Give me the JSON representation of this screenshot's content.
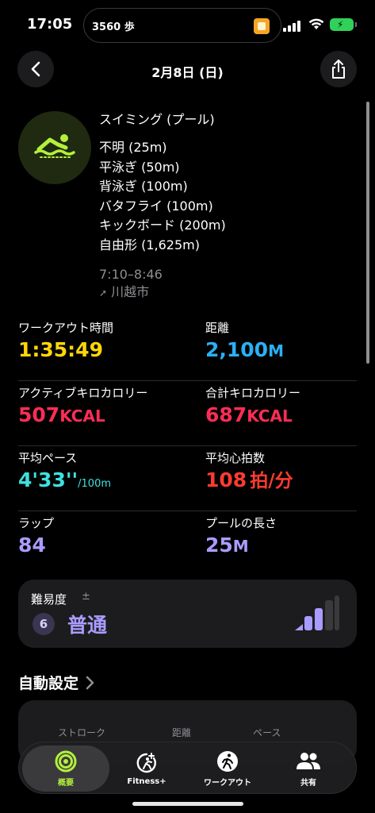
{
  "status": {
    "time": "17:05",
    "steps": "3560 歩"
  },
  "nav": {
    "title": "2月8日 (日)"
  },
  "summary": {
    "title": "スイミング (プール)",
    "strokes": [
      "不明 (25m)",
      "平泳ぎ (50m)",
      "背泳ぎ (100m)",
      "バタフライ (100m)",
      "キックボード (200m)",
      "自由形 (1,625m)"
    ],
    "time_range": "7:10–8:46",
    "location": "川越市"
  },
  "metrics": {
    "workout_time": {
      "label": "ワークアウト時間",
      "value": "1:35:49"
    },
    "distance": {
      "label": "距離",
      "value": "2,100",
      "unit": "M"
    },
    "active_cal": {
      "label": "アクティブキロカロリー",
      "value": "507",
      "unit": "KCAL"
    },
    "total_cal": {
      "label": "合計キロカロリー",
      "value": "687",
      "unit": "KCAL"
    },
    "avg_pace": {
      "label": "平均ペース",
      "value": "4'33''",
      "unit": "/100m"
    },
    "avg_hr": {
      "label": "平均心拍数",
      "value": "108",
      "unit": "拍/分"
    },
    "laps": {
      "label": "ラップ",
      "value": "84"
    },
    "pool_length": {
      "label": "プールの長さ",
      "value": "25",
      "unit": "M"
    }
  },
  "difficulty": {
    "label": "難易度",
    "plusminus": "±",
    "number": "6",
    "text": "普通"
  },
  "auto": {
    "title": "自動設定",
    "columns": [
      "ストローク",
      "距離",
      "ペース"
    ]
  },
  "tabs": [
    {
      "label": "概要"
    },
    {
      "label": "Fitness+"
    },
    {
      "label": "ワークアウト"
    },
    {
      "label": "共有"
    }
  ],
  "colors": {
    "yellow": "#ffd60a",
    "blue": "#2ab0f5",
    "red": "#ff2d55",
    "cyan": "#3be2e0",
    "orange_red": "#ff3b30",
    "purple": "#a99cff",
    "green": "#b4f03c"
  }
}
